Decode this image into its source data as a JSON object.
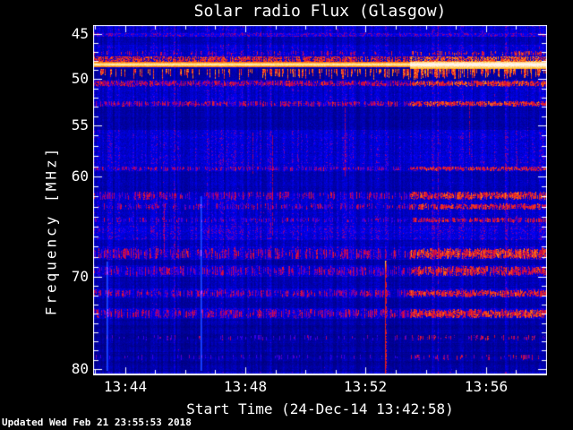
{
  "updated_text": "Updated Wed Feb 21 23:55:53 2018",
  "chart_data": {
    "type": "heatmap",
    "title": "Solar radio Flux (Glasgow)",
    "xlabel": "Start Time (24-Dec-14 13:42:58)",
    "ylabel": "Frequency [MHz]",
    "x_ticks": [
      "13:44",
      "13:48",
      "13:52",
      "13:56"
    ],
    "y_ticks": [
      "45",
      "50",
      "55",
      "60",
      "70",
      "80"
    ],
    "x_start_time": "13:42:58",
    "x_end_time": "13:58:00",
    "x_date": "24-Dec-14",
    "y_range_mhz": [
      45,
      80
    ],
    "y_axis_inverted": true,
    "legend": "none",
    "grid": false,
    "colormap": "blue background, purple-red-orange-yellow-white for increasing flux",
    "y_scale_anchors": [
      [
        45,
        0.0224
      ],
      [
        50,
        0.1524
      ],
      [
        55,
        0.2853
      ],
      [
        60,
        0.4319
      ],
      [
        70,
        0.7198
      ],
      [
        80,
        0.9846
      ]
    ],
    "features": {
      "regime_change_x_frac": 0.699,
      "bright_band": {
        "f": [
          48.05,
          48.7
        ],
        "f_after": [
          47.95,
          48.85
        ]
      },
      "red_row_above": {
        "f": [
          47.5,
          48.05
        ]
      },
      "hanging_dashes": {
        "f": [
          48.9,
          50.05
        ]
      },
      "burst": {
        "x_frac": 0.6436,
        "f": [
          68.4,
          80.2
        ]
      },
      "speckle_bands": [
        {
          "f": [
            46.9,
            47.45
          ],
          "density": 0.22,
          "intensity": 0.52
        },
        {
          "f": [
            50.15,
            50.8
          ],
          "density": 0.88,
          "intensity": 0.55
        },
        {
          "f": [
            52.35,
            52.95
          ],
          "density": 0.6,
          "intensity": 0.54
        },
        {
          "f": [
            59.0,
            59.45
          ],
          "density": 0.55,
          "intensity": 0.5
        },
        {
          "f": [
            61.5,
            62.3
          ],
          "density": 0.5,
          "intensity": 0.52
        },
        {
          "f": [
            62.7,
            63.3
          ],
          "density": 0.45,
          "intensity": 0.5
        },
        {
          "f": [
            64.1,
            64.6
          ],
          "density": 0.4,
          "intensity": 0.46
        },
        {
          "f": [
            67.15,
            68.25
          ],
          "density": 0.55,
          "intensity": 0.54
        },
        {
          "f": [
            68.95,
            69.9
          ],
          "density": 0.5,
          "intensity": 0.5
        },
        {
          "f": [
            71.4,
            72.2
          ],
          "density": 0.55,
          "intensity": 0.52
        },
        {
          "f": [
            73.5,
            74.5
          ],
          "density": 0.55,
          "intensity": 0.52
        },
        {
          "f": [
            76.3,
            76.9
          ],
          "density": 0.18,
          "intensity": 0.42
        },
        {
          "f": [
            78.4,
            79.0
          ],
          "density": 0.14,
          "intensity": 0.4
        }
      ],
      "background_rows": [
        {
          "f": [
            44.95,
            45.35
          ],
          "level": 1.5
        },
        {
          "f": [
            45.35,
            46.2
          ],
          "level": 0.75
        },
        {
          "f": [
            46.2,
            47.5
          ],
          "level": 1.0
        },
        {
          "f": [
            48.75,
            50.1
          ],
          "level": 0.6
        },
        {
          "f": [
            50.8,
            52.3
          ],
          "level": 0.95
        },
        {
          "f": [
            53.0,
            55.4
          ],
          "level": 0.68
        },
        {
          "f": [
            55.4,
            58.9
          ],
          "level": 1.0
        },
        {
          "f": [
            59.5,
            61.6
          ],
          "level": 0.78
        },
        {
          "f": [
            63.3,
            64.1
          ],
          "level": 0.95
        },
        {
          "f": [
            64.9,
            66.3
          ],
          "level": 1.15
        },
        {
          "f": [
            66.3,
            67.0
          ],
          "level": 0.8
        },
        {
          "f": [
            68.3,
            68.8
          ],
          "level": 0.65
        },
        {
          "f": [
            70.0,
            71.3
          ],
          "level": 0.75
        },
        {
          "f": [
            72.3,
            73.4
          ],
          "level": 0.7
        },
        {
          "f": [
            74.6,
            80.3
          ],
          "level": 0.62
        }
      ],
      "vertical_artifacts": [
        {
          "x_frac": 0.028,
          "f": [
            68.5,
            80.2
          ],
          "type": "light_blue"
        },
        {
          "x_frac": 0.235,
          "f": [
            62.0,
            80.2
          ],
          "type": "light_blue"
        },
        {
          "x_frac": 0.35,
          "f": [
            55.5,
            60.0
          ],
          "type": "faint_red"
        },
        {
          "x_frac": 0.555,
          "f": [
            52.0,
            60.0
          ],
          "type": "faint_red"
        },
        {
          "x_frac": 0.395,
          "f": [
            56.0,
            66.0
          ],
          "type": "faint_red"
        },
        {
          "x_frac": 0.155,
          "f": [
            63.0,
            67.5
          ],
          "type": "faint_red"
        },
        {
          "x_frac": 0.83,
          "f": [
            52.5,
            58.0
          ],
          "type": "faint_red"
        }
      ]
    },
    "annotations": {
      "bright_band": "Strong continuous RFI carrier at ~48.1-48.9 MHz (yellow-white line with red speckle above and orange dashes below)",
      "burst": "Narrow vertical red spike at ~13:52:40 spanning ~68.4-80 MHz with orange tip",
      "gain_step": "All interference bands intensify from ~13:53:30 to end of record"
    }
  }
}
